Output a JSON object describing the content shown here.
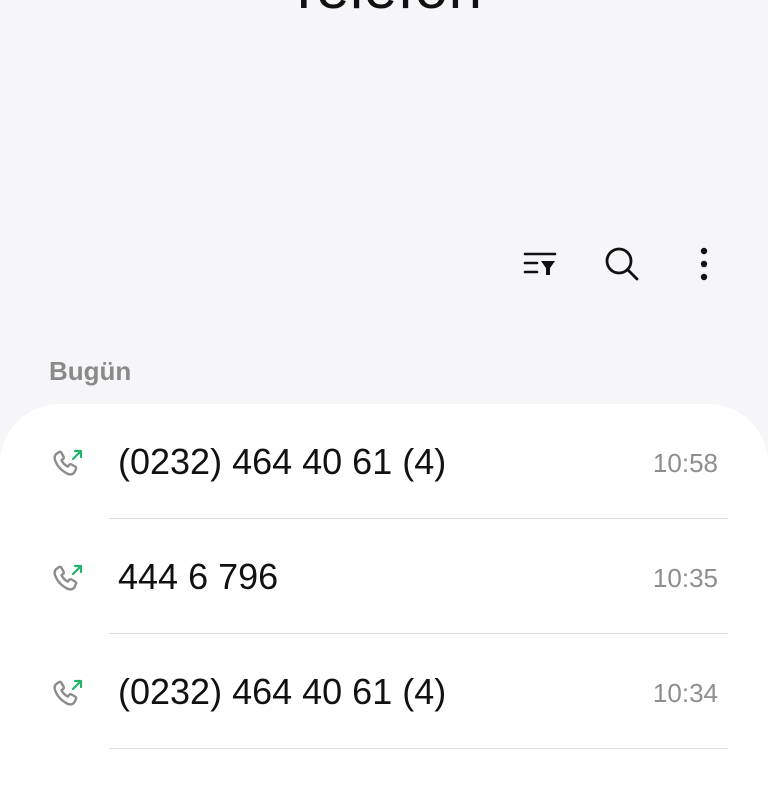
{
  "app": {
    "title": "Telefon"
  },
  "toolbar": {
    "buttons": [
      {
        "name": "filter",
        "icon": "filter-list-icon"
      },
      {
        "name": "search",
        "icon": "search-icon"
      },
      {
        "name": "more",
        "icon": "more-vertical-icon"
      }
    ]
  },
  "call_log": {
    "section_title": "Bugün",
    "items": [
      {
        "type": "outgoing",
        "icon": "outgoing-call-icon",
        "number": "(0232) 464 40 61 (4)",
        "time": "10:58"
      },
      {
        "type": "outgoing",
        "icon": "outgoing-call-icon",
        "number": "444 6 796",
        "time": "10:35"
      },
      {
        "type": "outgoing",
        "icon": "outgoing-call-icon",
        "number": "(0232) 464 40 61 (4)",
        "time": "10:34"
      }
    ]
  },
  "colors": {
    "background": "#f6f6f8",
    "card": "#ffffff",
    "handset": "#8c8c8c",
    "outgoing_arrow": "#23b36a",
    "secondary_text": "#8e8e8e",
    "divider": "#dedede"
  }
}
